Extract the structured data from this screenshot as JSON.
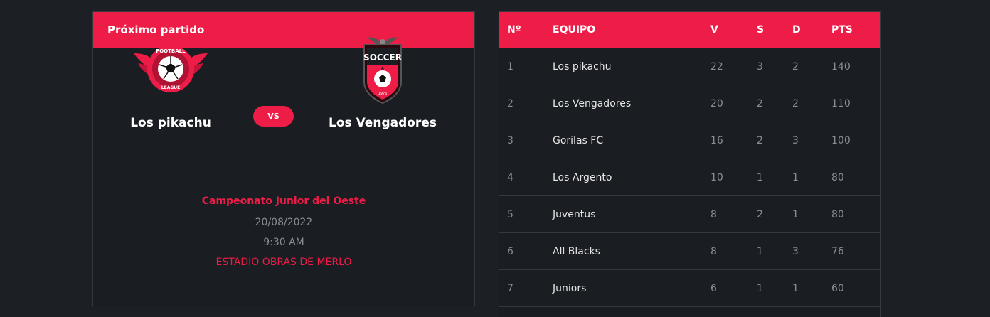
{
  "next_match": {
    "header": "Próximo partido",
    "home_team": "Los pikachu",
    "away_team": "Los Vengadores",
    "vs_label": "VS",
    "competition": "Campeonato Junior del Oeste",
    "date": "20/08/2022",
    "time": "9:30 AM",
    "venue": "ESTADIO OBRAS DE MERLO",
    "home_logo": {
      "icon": "football-league-wings-logo",
      "text_top": "FOOTBALL",
      "text_bottom": "LEAGUE"
    },
    "away_logo": {
      "icon": "soccer-shield-logo",
      "text": "SOCCER",
      "year": "1976"
    }
  },
  "standings": {
    "headers": {
      "num": "Nº",
      "team": "EQUIPO",
      "v": "V",
      "s": "S",
      "d": "D",
      "pts": "PTS"
    },
    "rows": [
      {
        "num": "1",
        "team": "Los pikachu",
        "v": "22",
        "s": "3",
        "d": "2",
        "pts": "140"
      },
      {
        "num": "2",
        "team": "Los Vengadores",
        "v": "20",
        "s": "2",
        "d": "2",
        "pts": "110"
      },
      {
        "num": "3",
        "team": "Gorilas FC",
        "v": "16",
        "s": "2",
        "d": "3",
        "pts": "100"
      },
      {
        "num": "4",
        "team": "Los Argento",
        "v": "10",
        "s": "1",
        "d": "1",
        "pts": "80"
      },
      {
        "num": "5",
        "team": "Juventus",
        "v": "8",
        "s": "2",
        "d": "1",
        "pts": "80"
      },
      {
        "num": "6",
        "team": "All Blacks",
        "v": "8",
        "s": "1",
        "d": "3",
        "pts": "76"
      },
      {
        "num": "7",
        "team": "Juniors",
        "v": "6",
        "s": "1",
        "d": "1",
        "pts": "60"
      }
    ]
  },
  "colors": {
    "accent": "#ee1d48",
    "background": "#1c1f24",
    "panel": "#1a1d21",
    "border": "#35393f"
  }
}
